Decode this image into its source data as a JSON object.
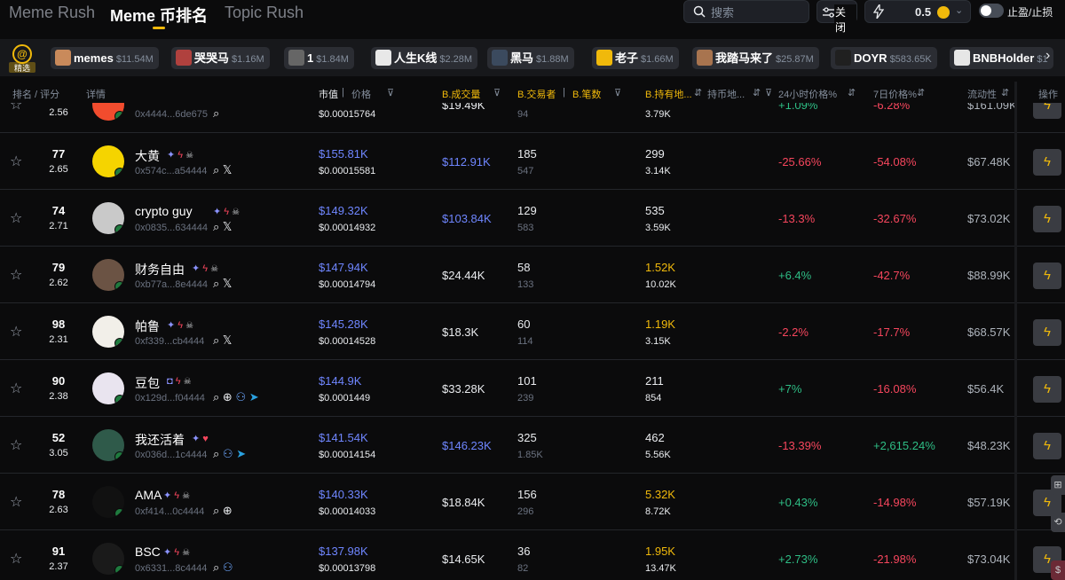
{
  "nav": {
    "tabs": [
      "Meme Rush",
      "Meme 币排名",
      "Topic Rush"
    ],
    "search_placeholder": "搜索",
    "filter_label": "关闭",
    "amount": "0.5",
    "tpsl_label": "止盈/止损"
  },
  "featured_label": "精选",
  "chips": [
    {
      "name": "memes",
      "mcap": "$11.54M",
      "color": "#c98a5b"
    },
    {
      "name": "哭哭马",
      "mcap": "$1.16M",
      "color": "#b0413e"
    },
    {
      "name": "1",
      "mcap": "$1.84M",
      "color": "#666666"
    },
    {
      "name": "人生K线",
      "mcap": "$2.28M",
      "color": "#e8e8e8"
    },
    {
      "name": "黑马",
      "mcap": "$1.88M",
      "color": "#3b4a5e"
    },
    {
      "name": "老子",
      "mcap": "$1.66M",
      "color": "#f0b90b"
    },
    {
      "name": "我踏马来了",
      "mcap": "$25.87M",
      "color": "#a8744f"
    },
    {
      "name": "DOYR",
      "mcap": "$583.65K",
      "color": "#202020"
    },
    {
      "name": "BNBHolder",
      "mcap": "$1",
      "color": "#e6e6e6"
    }
  ],
  "headers": {
    "rank": "排名 / 评分",
    "details": "详情",
    "mcap": "市值",
    "price": "价格",
    "volume": "B.成交量",
    "traders": "B.交易者",
    "txns": "B.笔数",
    "holders": "B.持有地...",
    "hold_addr": "持币地...",
    "chg24": "24小时价格%",
    "chg7": "7日价格%",
    "liquidity": "流动性",
    "action": "操作"
  },
  "rows": [
    {
      "rank": "",
      "score": "2.56",
      "name": "",
      "addr": "0x4444...6de675",
      "mcap": "",
      "price": "$0.00015764",
      "vol": "$19.49K",
      "vol_blue": false,
      "traders": "",
      "txns": "94",
      "holders": "",
      "holders_gold": false,
      "holders2": "3.79K",
      "chg24": "+1.09%",
      "chg7": "-6.28%",
      "liq": "$161.09K",
      "avatar": "#f24c2e",
      "badges": "",
      "links": "search"
    },
    {
      "rank": "77",
      "score": "2.65",
      "name": "大黄",
      "addr": "0x574c...a54444",
      "mcap": "$155.81K",
      "price": "$0.00015581",
      "vol": "$112.91K",
      "vol_blue": true,
      "traders": "185",
      "txns": "547",
      "holders": "299",
      "holders_gold": false,
      "holders2": "3.14K",
      "chg24": "-25.66%",
      "chg7": "-54.08%",
      "liq": "$67.48K",
      "avatar": "#f5d400",
      "badges": "sbk",
      "links": "sx"
    },
    {
      "rank": "74",
      "score": "2.71",
      "name": "crypto guy",
      "addr": "0x0835...634444",
      "mcap": "$149.32K",
      "price": "$0.00014932",
      "vol": "$103.84K",
      "vol_blue": true,
      "traders": "129",
      "txns": "583",
      "holders": "535",
      "holders_gold": false,
      "holders2": "3.59K",
      "chg24": "-13.3%",
      "chg7": "-32.67%",
      "liq": "$73.02K",
      "avatar": "#c9c9c9",
      "badges": "sbk",
      "links": "sx"
    },
    {
      "rank": "79",
      "score": "2.62",
      "name": "财务自由",
      "addr": "0xb77a...8e4444",
      "mcap": "$147.94K",
      "price": "$0.00014794",
      "vol": "$24.44K",
      "vol_blue": false,
      "traders": "58",
      "txns": "133",
      "holders": "1.52K",
      "holders_gold": true,
      "holders2": "10.02K",
      "chg24": "+6.4%",
      "chg7": "-42.7%",
      "liq": "$88.99K",
      "avatar": "#6b5344",
      "badges": "sbk",
      "links": "sx"
    },
    {
      "rank": "98",
      "score": "2.31",
      "name": "帕鲁",
      "addr": "0xf339...cb4444",
      "mcap": "$145.28K",
      "price": "$0.00014528",
      "vol": "$18.3K",
      "vol_blue": false,
      "traders": "60",
      "txns": "114",
      "holders": "1.19K",
      "holders_gold": true,
      "holders2": "3.15K",
      "chg24": "-2.2%",
      "chg7": "-17.7%",
      "liq": "$68.57K",
      "avatar": "#f2efe9",
      "badges": "sbk",
      "links": "sx"
    },
    {
      "rank": "90",
      "score": "2.38",
      "name": "豆包",
      "addr": "0x129d...f04444",
      "mcap": "$144.9K",
      "price": "$0.0001449",
      "vol": "$33.28K",
      "vol_blue": false,
      "traders": "101",
      "txns": "239",
      "holders": "211",
      "holders_gold": false,
      "holders2": "854",
      "chg24": "+7%",
      "chg7": "-16.08%",
      "liq": "$56.4K",
      "avatar": "#e9e4ef",
      "badges": "qbk",
      "links": "swpt"
    },
    {
      "rank": "52",
      "score": "3.05",
      "name": "我还活着",
      "addr": "0x036d...1c4444",
      "mcap": "$141.54K",
      "price": "$0.00014154",
      "vol": "$146.23K",
      "vol_blue": true,
      "traders": "325",
      "txns": "1.85K",
      "holders": "462",
      "holders_gold": false,
      "holders2": "5.56K",
      "chg24": "-13.39%",
      "chg7": "+2,615.24%",
      "liq": "$48.23K",
      "avatar": "#2f5a4a",
      "badges": "sh",
      "links": "spt"
    },
    {
      "rank": "78",
      "score": "2.63",
      "name": "AMA",
      "addr": "0xf414...0c4444",
      "mcap": "$140.33K",
      "price": "$0.00014033",
      "vol": "$18.84K",
      "vol_blue": false,
      "traders": "156",
      "txns": "296",
      "holders": "5.32K",
      "holders_gold": true,
      "holders2": "8.72K",
      "chg24": "+0.43%",
      "chg7": "-14.98%",
      "liq": "$57.19K",
      "avatar": "#111111",
      "badges": "sbk",
      "links": "sw"
    },
    {
      "rank": "91",
      "score": "2.37",
      "name": "BSC",
      "addr": "0x6331...8c4444",
      "mcap": "$137.98K",
      "price": "$0.00013798",
      "vol": "$14.65K",
      "vol_blue": false,
      "traders": "36",
      "txns": "82",
      "holders": "1.95K",
      "holders_gold": true,
      "holders2": "13.47K",
      "chg24": "+2.73%",
      "chg7": "-21.98%",
      "liq": "$73.04K",
      "avatar": "#1a1a1a",
      "badges": "sbk",
      "links": "sp"
    }
  ]
}
